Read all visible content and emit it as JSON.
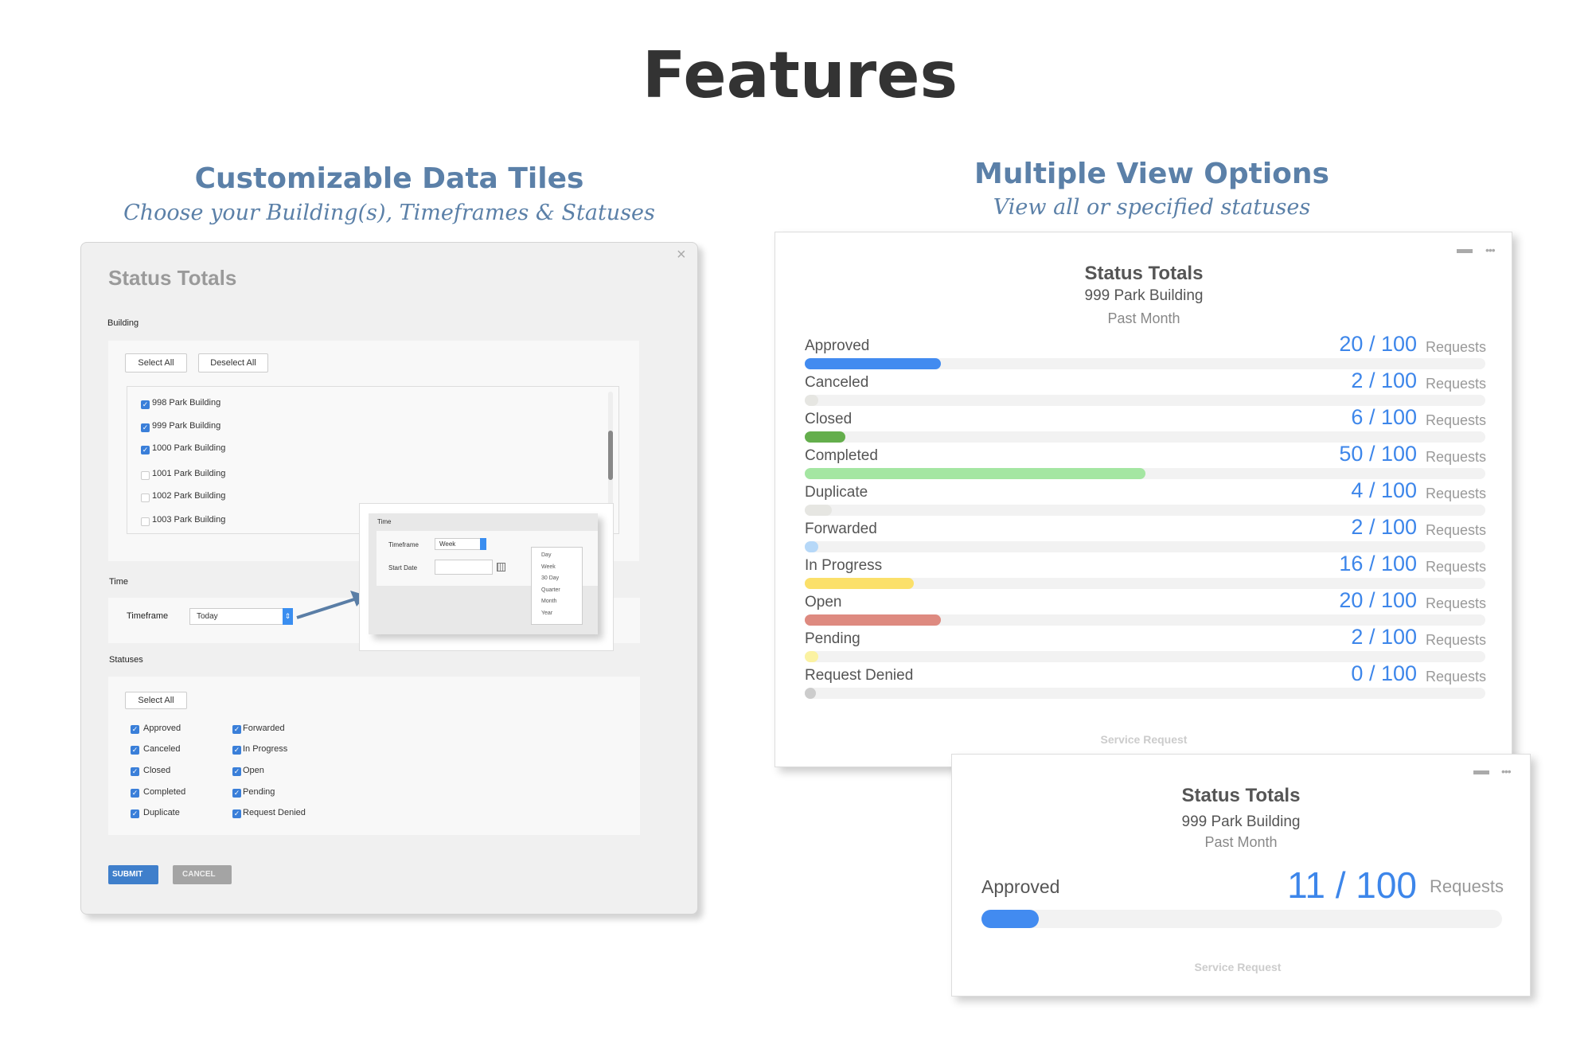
{
  "page": {
    "title": "Features"
  },
  "left_section": {
    "heading": "Customizable Data Tiles",
    "subheading": "Choose your Building(s), Timeframes & Statuses"
  },
  "right_section": {
    "heading": "Multiple View Options",
    "subheading": "View all or specified statuses"
  },
  "config_dialog": {
    "title": "Status Totals",
    "close_icon": "close-icon",
    "close": "×",
    "building": {
      "label": "Building",
      "select_all": "Select All",
      "deselect_all": "Deselect All",
      "items": [
        {
          "label": "998 Park Building",
          "checked": true
        },
        {
          "label": "999 Park Building",
          "checked": true
        },
        {
          "label": "1000 Park Building",
          "checked": true
        },
        {
          "label": "1001 Park Building",
          "checked": false
        },
        {
          "label": "1002 Park Building",
          "checked": false
        },
        {
          "label": "1003 Park Building",
          "checked": false
        }
      ]
    },
    "time": {
      "label": "Time",
      "timeframe_label": "Timeframe",
      "timeframe_value": "Today"
    },
    "time_popup": {
      "header": "Time",
      "timeframe_label": "Timeframe",
      "timeframe_value": "Week",
      "start_date_label": "Start Date",
      "start_date_value": "",
      "calendar_icon": "calendar-icon",
      "options": [
        "Day",
        "Week",
        "30 Day",
        "Quarter",
        "Month",
        "Year"
      ]
    },
    "statuses": {
      "label": "Statuses",
      "select_all": "Select All",
      "items": [
        {
          "label": "Approved",
          "checked": true
        },
        {
          "label": "Canceled",
          "checked": true
        },
        {
          "label": "Closed",
          "checked": true
        },
        {
          "label": "Completed",
          "checked": true
        },
        {
          "label": "Duplicate",
          "checked": true
        },
        {
          "label": "Forwarded",
          "checked": true
        },
        {
          "label": "In Progress",
          "checked": true
        },
        {
          "label": "Open",
          "checked": true
        },
        {
          "label": "Pending",
          "checked": true
        },
        {
          "label": "Request Denied",
          "checked": true
        }
      ]
    },
    "submit": "SUBMIT",
    "cancel": "CANCEL"
  },
  "tile_all": {
    "title": "Status Totals",
    "building": "999 Park Building",
    "period": "Past Month",
    "footer": "Service Request",
    "unit": "Requests",
    "rows": [
      {
        "label": "Approved",
        "value": 20,
        "total": 100,
        "text": "20 / 100",
        "color": "#428bf0"
      },
      {
        "label": "Canceled",
        "value": 2,
        "total": 100,
        "text": "2 / 100",
        "color": "#e6e6e2"
      },
      {
        "label": "Closed",
        "value": 6,
        "total": 100,
        "text": "6 / 100",
        "color": "#64ae4c"
      },
      {
        "label": "Completed",
        "value": 50,
        "total": 100,
        "text": "50 / 100",
        "color": "#a4e6a2"
      },
      {
        "label": "Duplicate",
        "value": 4,
        "total": 100,
        "text": "4 / 100",
        "color": "#e6e6e2"
      },
      {
        "label": "Forwarded",
        "value": 2,
        "total": 100,
        "text": "2 / 100",
        "color": "#b6d8f8"
      },
      {
        "label": "In Progress",
        "value": 16,
        "total": 100,
        "text": "16 / 100",
        "color": "#fbe06a"
      },
      {
        "label": "Open",
        "value": 20,
        "total": 100,
        "text": "20 / 100",
        "color": "#de8a80"
      },
      {
        "label": "Pending",
        "value": 2,
        "total": 100,
        "text": "2 / 100",
        "color": "#fbf2a2"
      },
      {
        "label": "Request Denied",
        "value": 0,
        "total": 100,
        "text": "0 / 100",
        "color": "#cccccc"
      }
    ]
  },
  "tile_single": {
    "title": "Status Totals",
    "building": "999 Park Building",
    "period": "Past Month",
    "footer": "Service Request",
    "unit": "Requests",
    "row": {
      "label": "Approved",
      "value": 11,
      "total": 100,
      "text": "11 / 100",
      "color": "#428bf0"
    }
  },
  "icons": {
    "minimize": "minimize-icon",
    "more": "more-dots-icon",
    "arrow": "arrow-icon"
  }
}
